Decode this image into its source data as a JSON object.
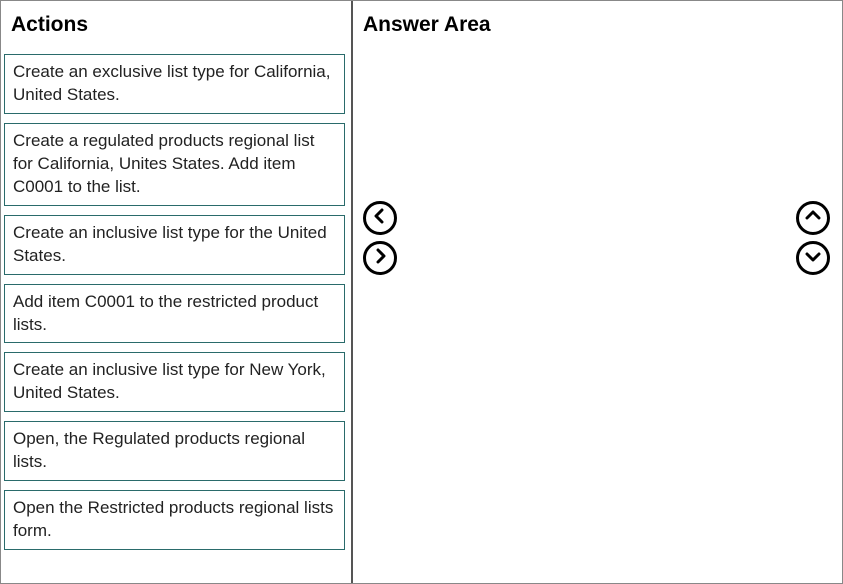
{
  "actions": {
    "header": "Actions",
    "items": [
      "Create an exclusive list type for California, United States.",
      "Create a regulated products regional list for California, Unites States. Add item C0001 to the list.",
      "Create an inclusive list type for the United States.",
      "Add item C0001 to the restricted product lists.",
      "Create an inclusive list type for New York, United States.",
      "Open, the Regulated products regional lists.",
      "Open the Restricted products regional lists form."
    ]
  },
  "answer": {
    "header": "Answer Area"
  }
}
